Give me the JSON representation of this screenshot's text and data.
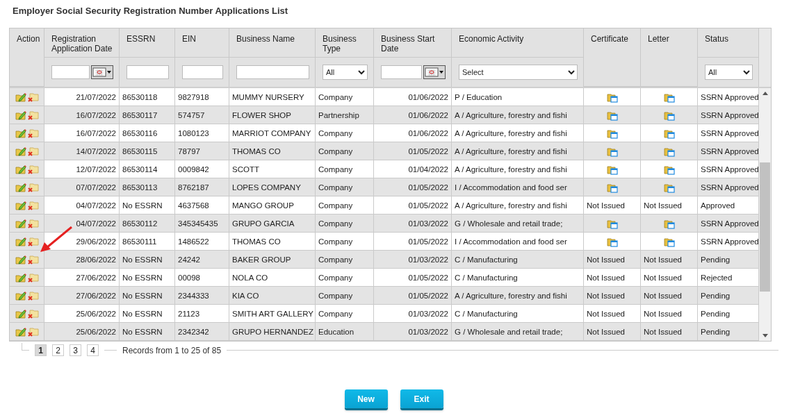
{
  "title": "Employer Social Security Registration Number Applications List",
  "table": {
    "columns": [
      "Action",
      "Registration Application Date",
      "ESSRN",
      "EIN",
      "Business Name",
      "Business Type",
      "Business Start Date",
      "Economic Activity",
      "Certificate",
      "Letter",
      "Status"
    ],
    "filters": {
      "registration_date": {
        "kind": "date"
      },
      "essrn": {
        "kind": "text"
      },
      "ein": {
        "kind": "text"
      },
      "business_name": {
        "kind": "text"
      },
      "business_type": {
        "kind": "select",
        "value": "All"
      },
      "start_date": {
        "kind": "date"
      },
      "economic_activity": {
        "kind": "select",
        "value": "Select"
      },
      "status": {
        "kind": "select",
        "value": "All"
      }
    },
    "rows": [
      {
        "date": "21/07/2022",
        "essrn": "86530118",
        "ein": "9827918",
        "name": "MUMMY NURSERY",
        "type": "Company",
        "start": "01/06/2022",
        "activity": "P / Education",
        "certificate": {
          "kind": "icon"
        },
        "letter": {
          "kind": "icon"
        },
        "status": "SSRN Approved"
      },
      {
        "date": "16/07/2022",
        "essrn": "86530117",
        "ein": "574757",
        "name": "FLOWER SHOP",
        "type": "Partnership",
        "start": "01/06/2022",
        "activity": "A / Agriculture, forestry and fishi",
        "certificate": {
          "kind": "icon"
        },
        "letter": {
          "kind": "icon"
        },
        "status": "SSRN Approved"
      },
      {
        "date": "16/07/2022",
        "essrn": "86530116",
        "ein": "1080123",
        "name": "MARRIOT COMPANY",
        "type": "Company",
        "start": "01/06/2022",
        "activity": "A / Agriculture, forestry and fishi",
        "certificate": {
          "kind": "icon"
        },
        "letter": {
          "kind": "icon"
        },
        "status": "SSRN Approved"
      },
      {
        "date": "14/07/2022",
        "essrn": "86530115",
        "ein": "78797",
        "name": "THOMAS CO",
        "type": "Company",
        "start": "01/05/2022",
        "activity": "A / Agriculture, forestry and fishi",
        "certificate": {
          "kind": "icon"
        },
        "letter": {
          "kind": "icon"
        },
        "status": "SSRN Approved"
      },
      {
        "date": "12/07/2022",
        "essrn": "86530114",
        "ein": "0009842",
        "name": "SCOTT",
        "type": "Company",
        "start": "01/04/2022",
        "activity": "A / Agriculture, forestry and fishi",
        "certificate": {
          "kind": "icon"
        },
        "letter": {
          "kind": "icon"
        },
        "status": "SSRN Approved"
      },
      {
        "date": "07/07/2022",
        "essrn": "86530113",
        "ein": "8762187",
        "name": "LOPES COMPANY",
        "type": "Company",
        "start": "01/05/2022",
        "activity": "I / Accommodation and food ser",
        "certificate": {
          "kind": "icon"
        },
        "letter": {
          "kind": "icon"
        },
        "status": "SSRN Approved"
      },
      {
        "date": "04/07/2022",
        "essrn": "No ESSRN",
        "ein": "4637568",
        "name": "MANGO GROUP",
        "type": "Company",
        "start": "01/05/2022",
        "activity": "A / Agriculture, forestry and fishi",
        "certificate": {
          "kind": "text",
          "text": "Not Issued"
        },
        "letter": {
          "kind": "text",
          "text": "Not Issued"
        },
        "status": "Approved"
      },
      {
        "date": "04/07/2022",
        "essrn": "86530112",
        "ein": "345345435",
        "name": "GRUPO GARCIA",
        "type": "Company",
        "start": "01/03/2022",
        "activity": "G / Wholesale and retail trade;",
        "certificate": {
          "kind": "icon"
        },
        "letter": {
          "kind": "icon"
        },
        "status": "SSRN Approved"
      },
      {
        "date": "29/06/2022",
        "essrn": "86530111",
        "ein": "1486522",
        "name": "THOMAS CO",
        "type": "Company",
        "start": "01/05/2022",
        "activity": "I / Accommodation and food ser",
        "certificate": {
          "kind": "icon"
        },
        "letter": {
          "kind": "icon"
        },
        "status": "SSRN Approved"
      },
      {
        "date": "28/06/2022",
        "essrn": "No ESSRN",
        "ein": "24242",
        "name": "BAKER GROUP",
        "type": "Company",
        "start": "01/03/2022",
        "activity": "C / Manufacturing",
        "certificate": {
          "kind": "text",
          "text": "Not Issued"
        },
        "letter": {
          "kind": "text",
          "text": "Not Issued"
        },
        "status": "Pending"
      },
      {
        "date": "27/06/2022",
        "essrn": "No ESSRN",
        "ein": "00098",
        "name": "NOLA CO",
        "type": "Company",
        "start": "01/05/2022",
        "activity": "C / Manufacturing",
        "certificate": {
          "kind": "text",
          "text": "Not Issued"
        },
        "letter": {
          "kind": "text",
          "text": "Not Issued"
        },
        "status": "Rejected"
      },
      {
        "date": "27/06/2022",
        "essrn": "No ESSRN",
        "ein": "2344333",
        "name": "KIA CO",
        "type": "Company",
        "start": "01/05/2022",
        "activity": "A / Agriculture, forestry and fishi",
        "certificate": {
          "kind": "text",
          "text": "Not Issued"
        },
        "letter": {
          "kind": "text",
          "text": "Not Issued"
        },
        "status": "Pending"
      },
      {
        "date": "25/06/2022",
        "essrn": "No ESSRN",
        "ein": "21123",
        "name": "SMITH ART GALLERY",
        "type": "Company",
        "start": "01/03/2022",
        "activity": "C / Manufacturing",
        "certificate": {
          "kind": "text",
          "text": "Not Issued"
        },
        "letter": {
          "kind": "text",
          "text": "Not Issued"
        },
        "status": "Pending"
      },
      {
        "date": "25/06/2022",
        "essrn": "No ESSRN",
        "ein": "2342342",
        "name": "GRUPO HERNANDEZ",
        "type": "Education",
        "start": "01/03/2022",
        "activity": "G / Wholesale and retail trade;",
        "certificate": {
          "kind": "text",
          "text": "Not Issued"
        },
        "letter": {
          "kind": "text",
          "text": "Not Issued"
        },
        "status": "Pending"
      }
    ]
  },
  "pagination": {
    "pages": [
      {
        "label": "1",
        "selected": true
      },
      {
        "label": "2",
        "selected": false
      },
      {
        "label": "3",
        "selected": false
      },
      {
        "label": "4",
        "selected": false
      }
    ],
    "records": "Records from 1 to 25 of 85"
  },
  "buttons": [
    "New",
    "Exit"
  ]
}
